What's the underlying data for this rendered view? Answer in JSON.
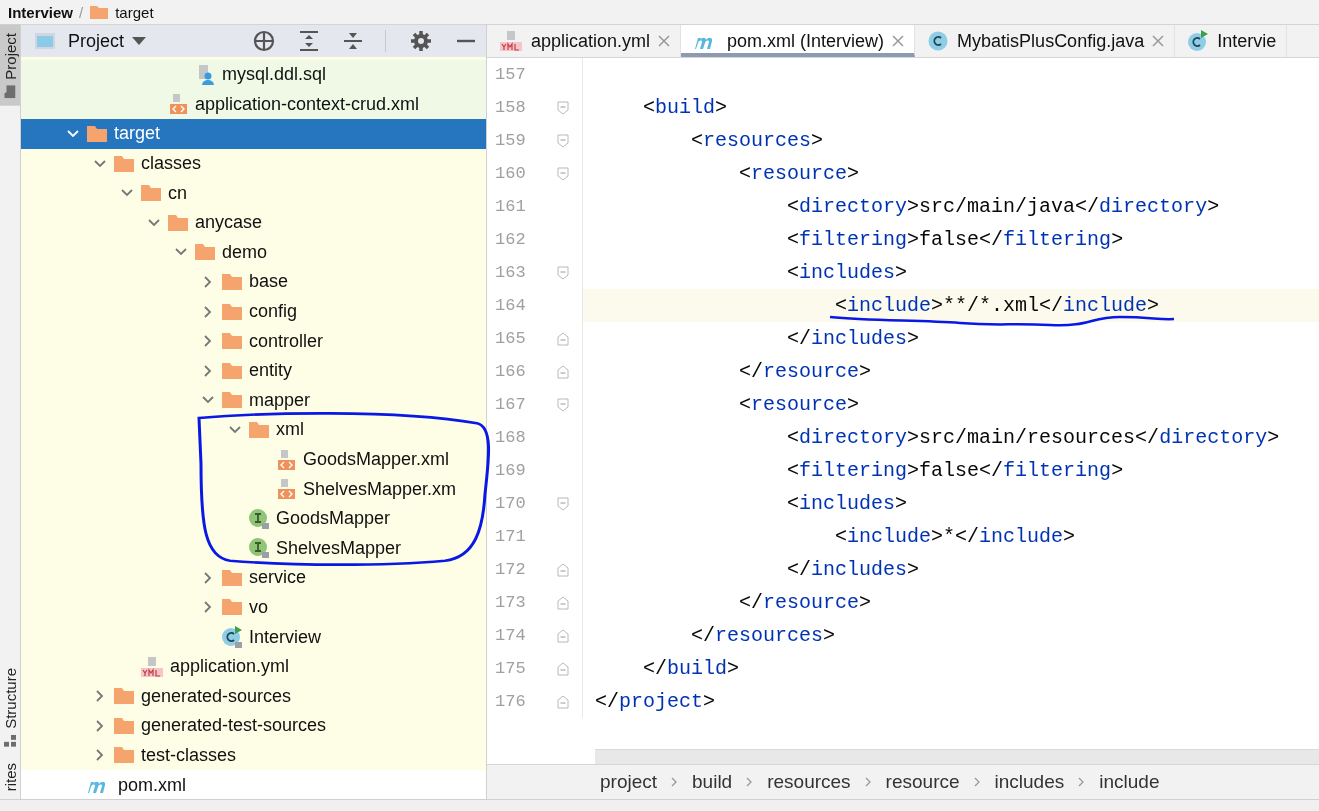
{
  "nav_bar": {
    "project": "Interview",
    "separator": "/",
    "folder": "target"
  },
  "side_stripe": [
    {
      "label": "Project",
      "selected": true
    },
    {
      "label": "Structure",
      "selected": false
    },
    {
      "label": "rites",
      "selected": false
    }
  ],
  "project_panel": {
    "title": "Project",
    "tree": [
      {
        "children": [
          {
            "children": [
              {
                "children": [
                  {
                    "children": [
                      {
                        "label": "mysql.ddl.sql",
                        "kind": "sql",
                        "color": "#eff9e6",
                        "selected": false
                      }
                    ]
                  },
                  {
                    "label": "application-context-crud.xml",
                    "kind": "xml",
                    "color": "#eff9e6",
                    "selected": false
                  }
                ]
              }
            ]
          }
        ]
      },
      {
        "label": "target",
        "kind": "folder",
        "selected": true,
        "expanded": true,
        "children": [
          {
            "label": "classes",
            "kind": "folder",
            "color": "#fefde6",
            "selected": false,
            "expanded": true,
            "children": [
              {
                "label": "cn",
                "kind": "folder",
                "color": "#fefde6",
                "selected": false,
                "expanded": true,
                "children": [
                  {
                    "label": "anycase",
                    "kind": "folder",
                    "color": "#fefde6",
                    "selected": false,
                    "expanded": true,
                    "children": [
                      {
                        "label": "demo",
                        "kind": "folder",
                        "color": "#fefde6",
                        "selected": false,
                        "expanded": true,
                        "children": [
                          {
                            "label": "base",
                            "kind": "folder",
                            "color": "#fefde6",
                            "selected": false,
                            "expanded": false
                          },
                          {
                            "label": "config",
                            "kind": "folder",
                            "color": "#fefde6",
                            "selected": false,
                            "expanded": false
                          },
                          {
                            "label": "controller",
                            "kind": "folder",
                            "color": "#fefde6",
                            "selected": false,
                            "expanded": false
                          },
                          {
                            "label": "entity",
                            "kind": "folder",
                            "color": "#fefde6",
                            "selected": false,
                            "expanded": false
                          },
                          {
                            "label": "mapper",
                            "kind": "folder",
                            "color": "#fefde6",
                            "selected": false,
                            "expanded": true,
                            "children": [
                              {
                                "label": "xml",
                                "kind": "folder",
                                "color": "#fefde6",
                                "selected": false,
                                "expanded": true,
                                "children": [
                                  {
                                    "label": "GoodsMapper.xml",
                                    "kind": "xml",
                                    "color": "#fefde6",
                                    "selected": false
                                  },
                                  {
                                    "label": "ShelvesMapper.xm",
                                    "kind": "xml",
                                    "color": "#fefde6",
                                    "selected": false
                                  }
                                ]
                              },
                              {
                                "label": "GoodsMapper",
                                "kind": "interface",
                                "color": "#fefde6",
                                "selected": false
                              },
                              {
                                "label": "ShelvesMapper",
                                "kind": "interface",
                                "color": "#fefde6",
                                "selected": false
                              }
                            ]
                          },
                          {
                            "label": "service",
                            "kind": "folder",
                            "color": "#fefde6",
                            "selected": false,
                            "expanded": false
                          },
                          {
                            "label": "vo",
                            "kind": "folder",
                            "color": "#fefde6",
                            "selected": false,
                            "expanded": false
                          },
                          {
                            "label": "Interview",
                            "kind": "main-class",
                            "color": "#fefde6",
                            "selected": false
                          }
                        ]
                      }
                    ]
                  }
                ]
              },
              {
                "label": "application.yml",
                "kind": "yml",
                "color": "#fefde6",
                "selected": false
              }
            ]
          },
          {
            "label": "generated-sources",
            "kind": "folder",
            "color": "#fefde6",
            "selected": false,
            "expanded": false
          },
          {
            "label": "generated-test-sources",
            "kind": "folder",
            "color": "#fefde6",
            "selected": false,
            "expanded": false
          },
          {
            "label": "test-classes",
            "kind": "folder",
            "color": "#fefde6",
            "selected": false,
            "expanded": false
          }
        ]
      },
      {
        "label": "pom.xml",
        "kind": "maven",
        "color": "#ffffff",
        "selected": false
      }
    ]
  },
  "editor": {
    "tabs": [
      {
        "label": "application.yml",
        "kind": "yml",
        "selected": false,
        "closable": true
      },
      {
        "label": "pom.xml (Interview)",
        "kind": "maven",
        "selected": true,
        "closable": true
      },
      {
        "label": "MybatisPlusConfig.java",
        "kind": "class",
        "selected": false,
        "closable": true
      },
      {
        "label": "Intervie",
        "kind": "main-class",
        "selected": false,
        "closable": false
      }
    ],
    "lines": [
      {
        "number": "157",
        "current": false,
        "fold_start": false,
        "fold_end": false
      },
      {
        "number": "158",
        "current": false,
        "fold_start": true,
        "fold_end": false,
        "tokens": [
          {
            "kind": "punct",
            "text": "    <"
          },
          {
            "kind": "tag",
            "text": "build"
          },
          {
            "kind": "punct",
            "text": ">"
          }
        ]
      },
      {
        "number": "159",
        "current": false,
        "fold_start": true,
        "fold_end": false,
        "tokens": [
          {
            "kind": "punct",
            "text": "        <"
          },
          {
            "kind": "tag",
            "text": "resources"
          },
          {
            "kind": "punct",
            "text": ">"
          }
        ]
      },
      {
        "number": "160",
        "current": false,
        "fold_start": true,
        "fold_end": false,
        "tokens": [
          {
            "kind": "punct",
            "text": "            <"
          },
          {
            "kind": "tag",
            "text": "resource"
          },
          {
            "kind": "punct",
            "text": ">"
          }
        ]
      },
      {
        "number": "161",
        "current": false,
        "fold_start": false,
        "fold_end": false,
        "tokens": [
          {
            "kind": "punct",
            "text": "                <"
          },
          {
            "kind": "tag",
            "text": "directory"
          },
          {
            "kind": "punct",
            "text": ">src/main/java</"
          },
          {
            "kind": "tag",
            "text": "directory"
          },
          {
            "kind": "punct",
            "text": ">"
          }
        ]
      },
      {
        "number": "162",
        "current": false,
        "fold_start": false,
        "fold_end": false,
        "tokens": [
          {
            "kind": "punct",
            "text": "                <"
          },
          {
            "kind": "tag",
            "text": "filtering"
          },
          {
            "kind": "punct",
            "text": ">false</"
          },
          {
            "kind": "tag",
            "text": "filtering"
          },
          {
            "kind": "punct",
            "text": ">"
          }
        ]
      },
      {
        "number": "163",
        "current": false,
        "fold_start": true,
        "fold_end": false,
        "tokens": [
          {
            "kind": "punct",
            "text": "                <"
          },
          {
            "kind": "tag",
            "text": "includes"
          },
          {
            "kind": "punct",
            "text": ">"
          }
        ]
      },
      {
        "number": "164",
        "current": true,
        "fold_start": false,
        "fold_end": false,
        "tokens": [
          {
            "kind": "punct",
            "text": "                    <"
          },
          {
            "kind": "tag",
            "text": "include"
          },
          {
            "kind": "punct",
            "text": ">**/*.xml</"
          },
          {
            "kind": "tag",
            "text": "include"
          },
          {
            "kind": "punct",
            "text": ">"
          }
        ]
      },
      {
        "number": "165",
        "current": false,
        "fold_start": false,
        "fold_end": true,
        "tokens": [
          {
            "kind": "punct",
            "text": "                </"
          },
          {
            "kind": "tag",
            "text": "includes"
          },
          {
            "kind": "punct",
            "text": ">"
          }
        ]
      },
      {
        "number": "166",
        "current": false,
        "fold_start": false,
        "fold_end": true,
        "tokens": [
          {
            "kind": "punct",
            "text": "            </"
          },
          {
            "kind": "tag",
            "text": "resource"
          },
          {
            "kind": "punct",
            "text": ">"
          }
        ]
      },
      {
        "number": "167",
        "current": false,
        "fold_start": true,
        "fold_end": false,
        "tokens": [
          {
            "kind": "punct",
            "text": "            <"
          },
          {
            "kind": "tag",
            "text": "resource"
          },
          {
            "kind": "punct",
            "text": ">"
          }
        ]
      },
      {
        "number": "168",
        "current": false,
        "fold_start": false,
        "fold_end": false,
        "tokens": [
          {
            "kind": "punct",
            "text": "                <"
          },
          {
            "kind": "tag",
            "text": "directory"
          },
          {
            "kind": "punct",
            "text": ">src/main/resources</"
          },
          {
            "kind": "tag",
            "text": "directory"
          },
          {
            "kind": "punct",
            "text": ">"
          }
        ]
      },
      {
        "number": "169",
        "current": false,
        "fold_start": false,
        "fold_end": false,
        "tokens": [
          {
            "kind": "punct",
            "text": "                <"
          },
          {
            "kind": "tag",
            "text": "filtering"
          },
          {
            "kind": "punct",
            "text": ">false</"
          },
          {
            "kind": "tag",
            "text": "filtering"
          },
          {
            "kind": "punct",
            "text": ">"
          }
        ]
      },
      {
        "number": "170",
        "current": false,
        "fold_start": true,
        "fold_end": false,
        "tokens": [
          {
            "kind": "punct",
            "text": "                <"
          },
          {
            "kind": "tag",
            "text": "includes"
          },
          {
            "kind": "punct",
            "text": ">"
          }
        ]
      },
      {
        "number": "171",
        "current": false,
        "fold_start": false,
        "fold_end": false,
        "tokens": [
          {
            "kind": "punct",
            "text": "                    <"
          },
          {
            "kind": "tag",
            "text": "include"
          },
          {
            "kind": "punct",
            "text": ">*</"
          },
          {
            "kind": "tag",
            "text": "include"
          },
          {
            "kind": "punct",
            "text": ">"
          }
        ]
      },
      {
        "number": "172",
        "current": false,
        "fold_start": false,
        "fold_end": true,
        "tokens": [
          {
            "kind": "punct",
            "text": "                </"
          },
          {
            "kind": "tag",
            "text": "includes"
          },
          {
            "kind": "punct",
            "text": ">"
          }
        ]
      },
      {
        "number": "173",
        "current": false,
        "fold_start": false,
        "fold_end": true,
        "tokens": [
          {
            "kind": "punct",
            "text": "            </"
          },
          {
            "kind": "tag",
            "text": "resource"
          },
          {
            "kind": "punct",
            "text": ">"
          }
        ]
      },
      {
        "number": "174",
        "current": false,
        "fold_start": false,
        "fold_end": true,
        "tokens": [
          {
            "kind": "punct",
            "text": "        </"
          },
          {
            "kind": "tag",
            "text": "resources"
          },
          {
            "kind": "punct",
            "text": ">"
          }
        ]
      },
      {
        "number": "175",
        "current": false,
        "fold_start": false,
        "fold_end": true,
        "tokens": [
          {
            "kind": "punct",
            "text": "    </"
          },
          {
            "kind": "tag",
            "text": "build"
          },
          {
            "kind": "punct",
            "text": ">"
          }
        ]
      },
      {
        "number": "176",
        "current": false,
        "fold_start": false,
        "fold_end": true,
        "tokens": [
          {
            "kind": "punct",
            "text": "</"
          },
          {
            "kind": "tag",
            "text": "project"
          },
          {
            "kind": "punct",
            "text": ">"
          }
        ]
      }
    ],
    "breadcrumbs": [
      "project",
      "build",
      "resources",
      "resource",
      "includes",
      "include"
    ]
  }
}
